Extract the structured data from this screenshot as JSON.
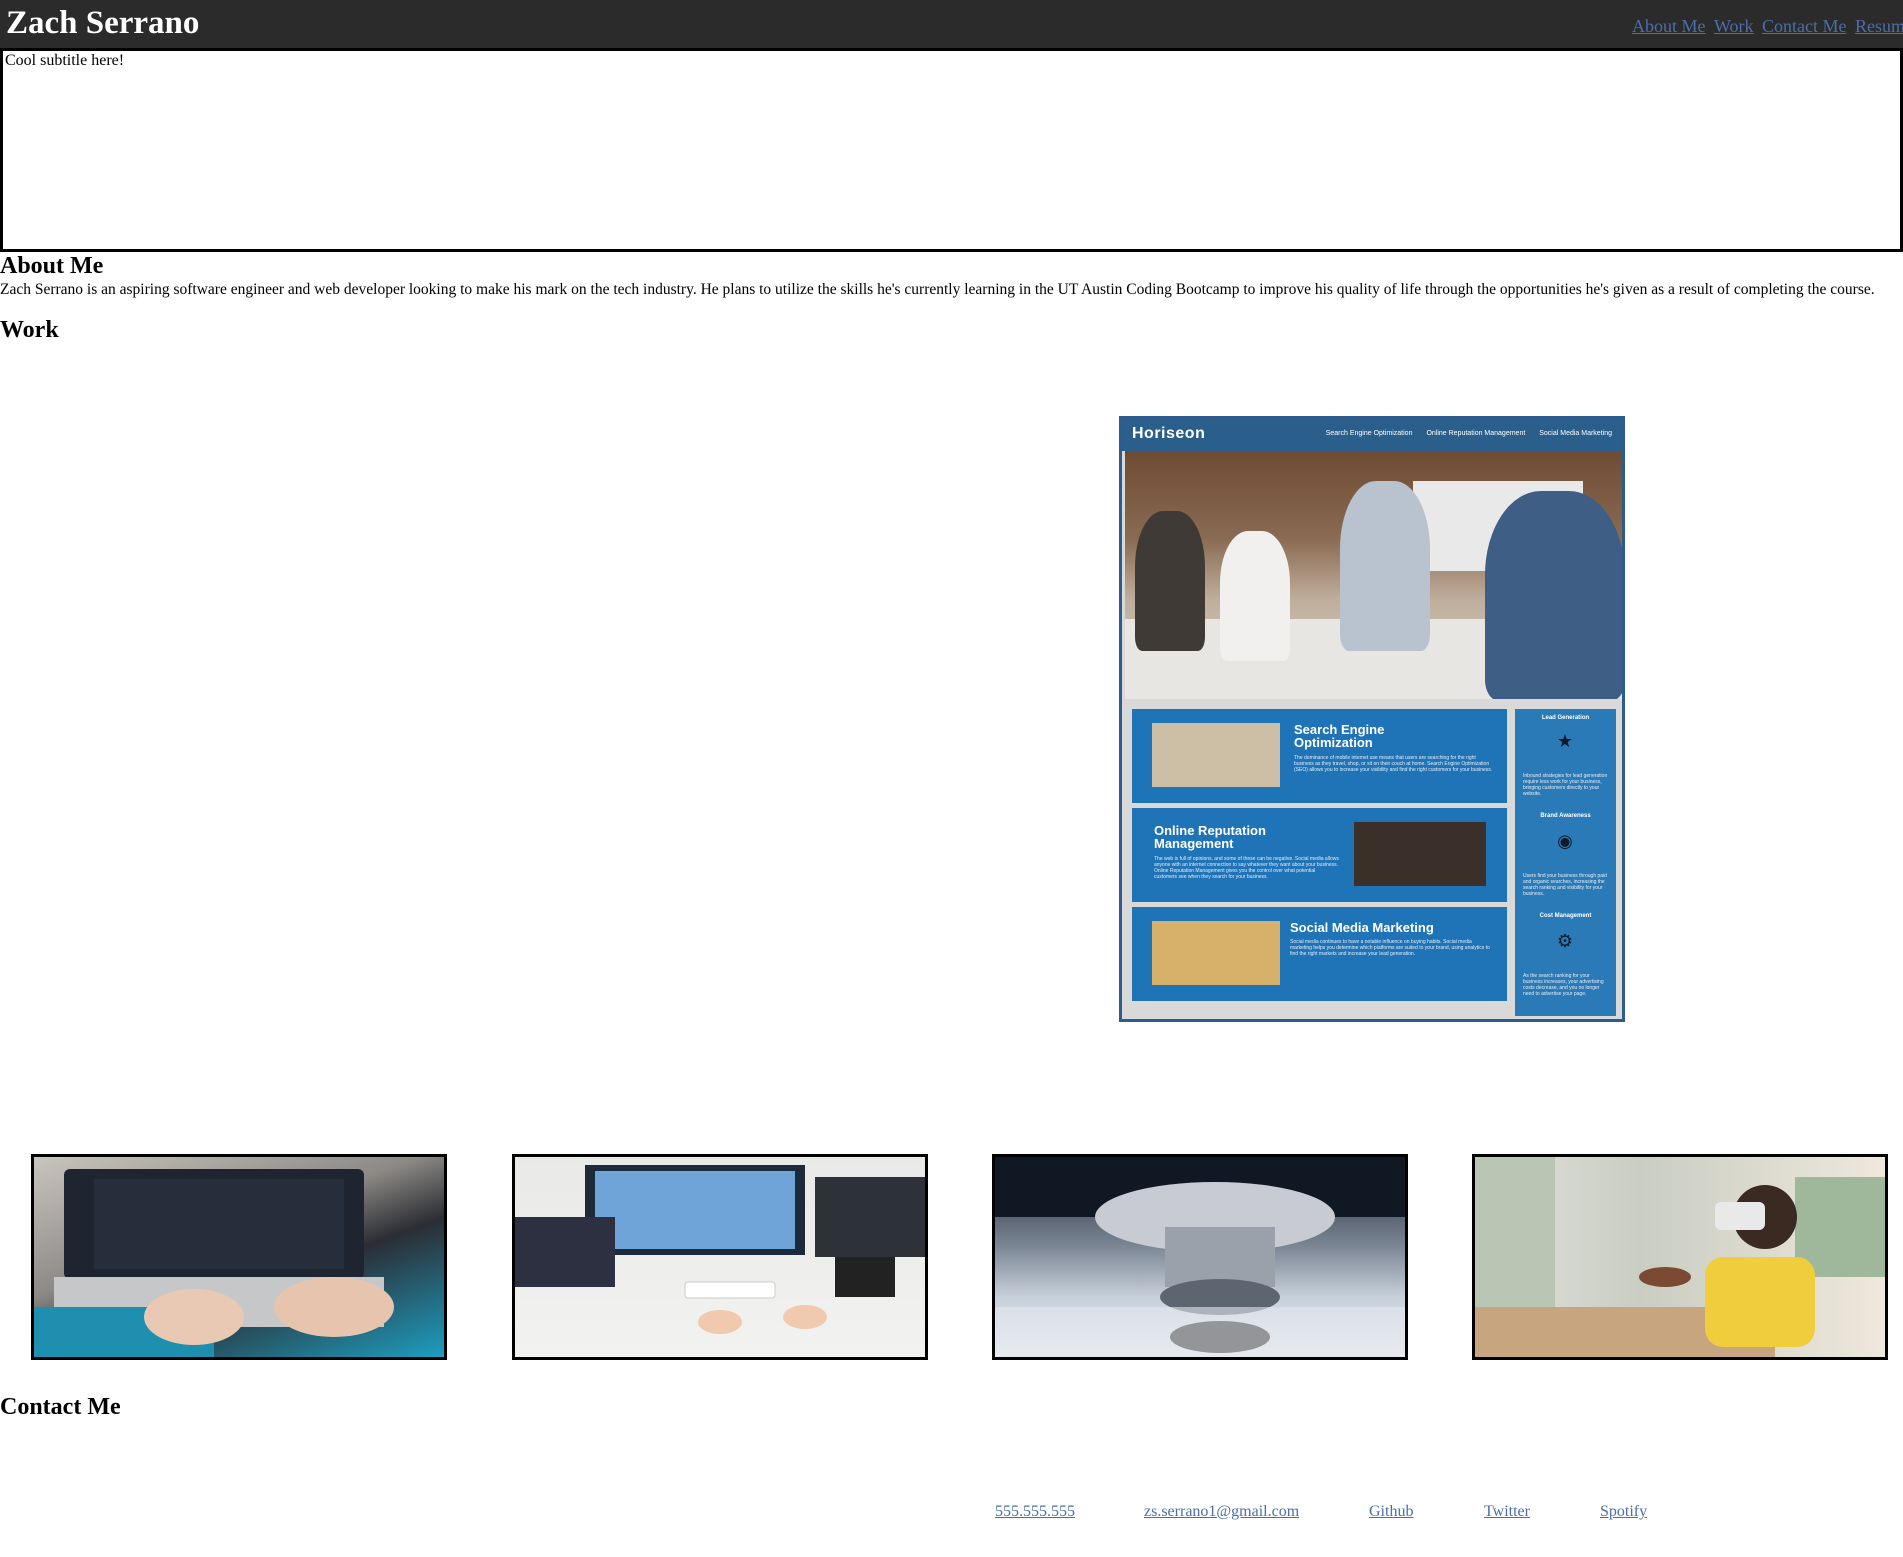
{
  "header": {
    "name": "Zach Serrano",
    "nav": [
      {
        "label": "About Me"
      },
      {
        "label": "Work"
      },
      {
        "label": "Contact Me"
      },
      {
        "label": "Resume"
      }
    ]
  },
  "hero": {
    "subtitle": "Cool subtitle here!"
  },
  "about": {
    "heading": "About Me",
    "text": "Zach Serrano is an aspiring software engineer and web developer looking to make his mark on the tech industry. He plans to utilize the skills he's currently learning in the UT Austin Coding Bootcamp to improve his quality of life through the opportunities he's given as a result of completing the course."
  },
  "work": {
    "heading": "Work",
    "featured": {
      "logo": "Horiseon",
      "nav": [
        "Search Engine Optimization",
        "Online Reputation Management",
        "Social Media Marketing"
      ],
      "cards": [
        {
          "title_line1": "Search Engine",
          "title_line2": "Optimization",
          "body": "The dominance of mobile internet use means that users are searching for the right business as they travel, shop, or sit on their couch at home. Search Engine Optimization (SEO) allows you to increase your visibility and find the right customers for your business."
        },
        {
          "title_line1": "Online Reputation",
          "title_line2": "Management",
          "body": "The web is full of opinions, and some of these can be negative. Social media allows anyone with an internet connection to say whatever they want about your business. Online Reputation Management gives you the control over what potential customers see when they search for your business."
        },
        {
          "title_line1": "Social Media Marketing",
          "title_line2": "",
          "body": "Social media continues to have a notable influence on buying habits. Social media marketing helps you determine which platforms are suited to your brand, using analytics to find the right markets and increase your lead generation."
        }
      ],
      "side": [
        {
          "title": "Lead Generation",
          "icon": "lightbulb-icon",
          "body": "Inbound strategies for lead generation require less work for your business, bringing customers directly to your website."
        },
        {
          "title": "Brand Awareness",
          "icon": "broadcast-icon",
          "body": "Users find your business through paid and organic searches, increasing the search ranking and visibility for your business."
        },
        {
          "title": "Cost Management",
          "icon": "gear-dollar-icon",
          "body": "As the search ranking for your business increases, your advertising costs decrease, and you no longer need to advertise your page."
        }
      ]
    },
    "gallery": [
      {
        "name": "laptop-coding-image"
      },
      {
        "name": "desk-monitors-image"
      },
      {
        "name": "microscope-image"
      },
      {
        "name": "vr-headset-image"
      }
    ]
  },
  "contact": {
    "heading": "Contact Me",
    "links": [
      {
        "label": "555.555.555"
      },
      {
        "label": "zs.serrano1@gmail.com"
      },
      {
        "label": "Github"
      },
      {
        "label": "Twitter"
      },
      {
        "label": "Spotify"
      }
    ]
  }
}
